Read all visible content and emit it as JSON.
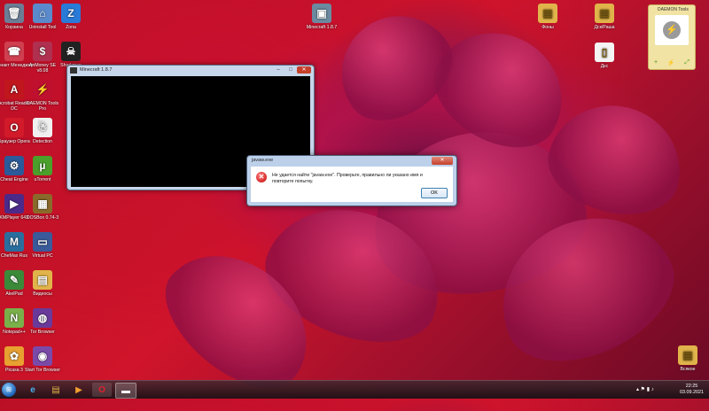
{
  "desktop": {
    "icons_left": [
      {
        "label": "Корзина",
        "glyph": "🗑",
        "color": "#6b7e96",
        "icon": "recycle-bin-icon"
      },
      {
        "label": "Конакт Менеджер",
        "glyph": "☎",
        "color": "#d04050",
        "icon": "contact-manager-icon"
      },
      {
        "label": "Acrobat Reader DC",
        "glyph": "A",
        "color": "#c0161d",
        "icon": "acrobat-icon"
      },
      {
        "label": "Браузер Opera",
        "glyph": "O",
        "color": "#d21a2a",
        "icon": "opera-icon"
      },
      {
        "label": "Cheat Engine",
        "glyph": "⚙",
        "color": "#2a5a9a",
        "icon": "cheat-engine-icon"
      },
      {
        "label": "KMPlayer 64X",
        "glyph": "▶",
        "color": "#4b2a8a",
        "icon": "kmplayer-icon"
      },
      {
        "label": "CheMax Rus",
        "glyph": "M",
        "color": "#2a6e9e",
        "icon": "chemax-icon"
      },
      {
        "label": "AkelPad",
        "glyph": "✎",
        "color": "#3a8a3a",
        "icon": "akelpad-icon"
      },
      {
        "label": "Notepad++",
        "glyph": "N",
        "color": "#7ab04a",
        "icon": "notepadpp-icon"
      },
      {
        "label": "Picasa 3",
        "glyph": "✿",
        "color": "#e8a030",
        "icon": "picasa-icon"
      }
    ],
    "icons_col2": [
      {
        "label": "Uninstall Tool",
        "glyph": "⌂",
        "color": "#5a8acb",
        "icon": "uninstall-tool-icon"
      },
      {
        "label": "AnMoney SE v8.08",
        "glyph": "$",
        "color": "#b03050",
        "icon": "anmoney-icon"
      },
      {
        "label": "DAEMON Tools Pro",
        "glyph": "⚡",
        "color": "#c01030",
        "icon": "daemon-tools-icon"
      },
      {
        "label": "Detection",
        "glyph": "☃",
        "color": "#f0f0f0",
        "icon": "detection-icon"
      },
      {
        "label": "uTorrent",
        "glyph": "µ",
        "color": "#4aa02a",
        "icon": "utorrent-icon"
      },
      {
        "label": "DOSBox 0.74-3",
        "glyph": "▦",
        "color": "#8a6a2a",
        "icon": "dosbox-icon"
      },
      {
        "label": "Virtual PC",
        "glyph": "▭",
        "color": "#3a5a9a",
        "icon": "virtual-pc-icon"
      },
      {
        "label": "Видеосы",
        "glyph": "▤",
        "color": "#e0b44a",
        "icon": "folder-icon"
      },
      {
        "label": "Tor Browser",
        "glyph": "◍",
        "color": "#6a3a9a",
        "icon": "tor-icon"
      },
      {
        "label": "Start Tor Browser",
        "glyph": "◉",
        "color": "#7a4aa8",
        "icon": "tor-start-icon"
      }
    ],
    "icons_col3": [
      {
        "label": "Zona",
        "glyph": "Z",
        "color": "#2a7ad8",
        "icon": "zona-icon"
      },
      {
        "label": "Sharkman",
        "glyph": "☠",
        "color": "#222222",
        "icon": "sharkman-icon"
      }
    ],
    "icons_top": [
      {
        "label": "Minecraft 1.8.7",
        "glyph": "▣",
        "color": "#6b8aa0",
        "icon": "minecraft-icon"
      }
    ],
    "icons_right": [
      {
        "label": "Фоны",
        "glyph": "▤",
        "color": "#e0b44a",
        "icon": "folder-icon"
      },
      {
        "label": "Дск/Раша",
        "glyph": "▤",
        "color": "#e0b44a",
        "icon": "folder-icon"
      },
      {
        "label": "Дкс",
        "glyph": "▯",
        "color": "#f4f4f4",
        "icon": "document-icon"
      },
      {
        "label": "Всякое",
        "glyph": "▤",
        "color": "#e0b44a",
        "icon": "folder-icon"
      }
    ]
  },
  "window": {
    "title": "Minecraft 1.8.7",
    "minimize": "–",
    "maximize": "□",
    "close": "✕"
  },
  "dialog": {
    "title": "javaw.exe",
    "message": "Не удается найти \"javaw.exe\". Проверьте, правильно ли указано имя и повторите попытку.",
    "ok_label": "OK",
    "close": "✕"
  },
  "gadget": {
    "title": "DAEMON Tools",
    "glyph": "⚡",
    "actions": [
      "+",
      "⚡",
      "⤢"
    ]
  },
  "taskbar": {
    "items": [
      {
        "name": "start-button",
        "glyph": "⊞"
      },
      {
        "name": "ie-icon",
        "glyph": "e"
      },
      {
        "name": "explorer-icon",
        "glyph": "▤"
      },
      {
        "name": "media-player-icon",
        "glyph": "▶"
      },
      {
        "name": "opera-taskbar-icon",
        "glyph": "O"
      },
      {
        "name": "console-taskbar-icon",
        "glyph": "▬"
      }
    ],
    "time": "22:25",
    "date": "03.09.2021"
  }
}
